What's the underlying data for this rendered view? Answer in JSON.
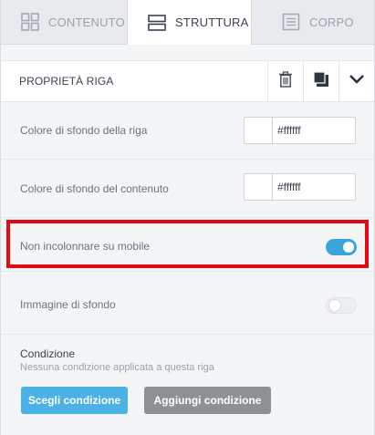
{
  "tabs": [
    {
      "label": "CONTENUTO",
      "icon": "grid-icon",
      "active": false
    },
    {
      "label": "STRUTTURA",
      "icon": "rows-icon",
      "active": true
    },
    {
      "label": "CORPO",
      "icon": "document-icon",
      "active": false
    }
  ],
  "header": {
    "title": "PROPRIETÀ RIGA",
    "actions": [
      "trash-icon",
      "duplicate-icon",
      "chevron-down-icon"
    ]
  },
  "fields": {
    "row_bg": {
      "label": "Colore di sfondo della riga",
      "value": "#ffffff"
    },
    "content_bg": {
      "label": "Colore di sfondo del contenuto",
      "value": "#ffffff"
    },
    "no_stack_mobile": {
      "label": "Non incolonnare su mobile",
      "enabled": true
    },
    "bg_image": {
      "label": "Immagine di sfondo",
      "enabled": false
    }
  },
  "condition": {
    "title": "Condizione",
    "subtitle": "Nessuna condizione applicata a questa riga",
    "choose_label": "Scegli condizione",
    "add_label": "Aggiungi condizione"
  },
  "colors": {
    "accent": "#3ba5db",
    "primary_button": "#4cb1e6",
    "secondary_button": "#8d9196",
    "highlight": "#e50914"
  }
}
